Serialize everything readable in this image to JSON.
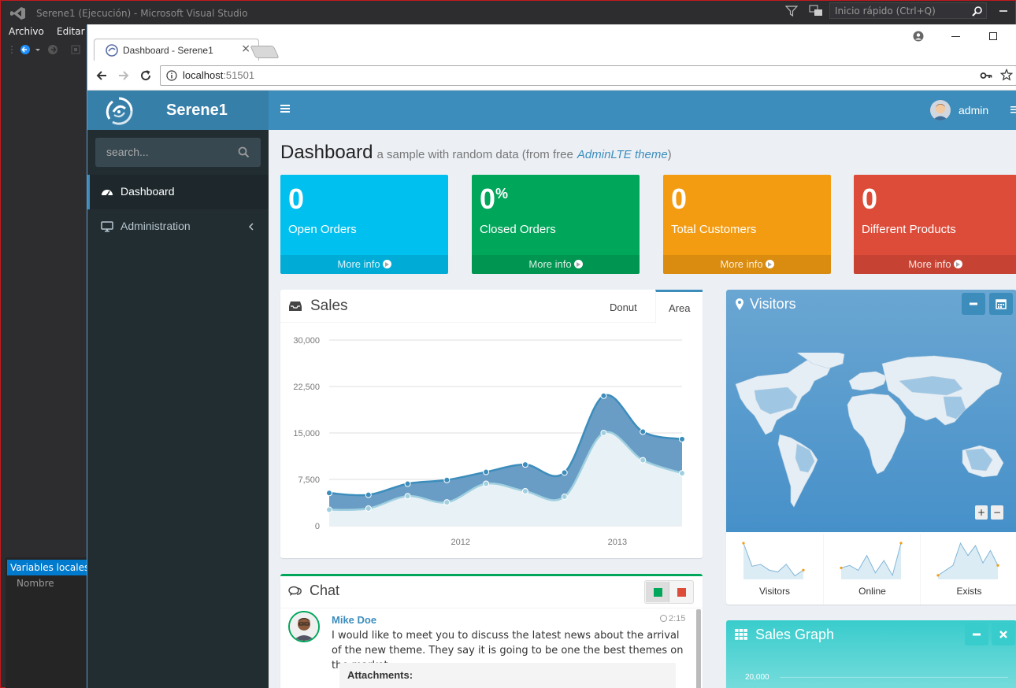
{
  "vs": {
    "title": "Serene1 (Ejecución) - Microsoft Visual Studio",
    "quick_launch": "Inicio rápido (Ctrl+Q)",
    "menu": [
      "Archivo",
      "Editar"
    ],
    "locals_tab": "Variables locales",
    "locals_column": "Nombre"
  },
  "browser": {
    "tab_title": "Dashboard - Serene1",
    "tab_close": "×",
    "url_host": "localhost",
    "url_port": ":51501"
  },
  "app": {
    "logo_text": "Serene1",
    "user": "admin",
    "search_placeholder": "search...",
    "nav": [
      {
        "label": "Dashboard",
        "active": true
      },
      {
        "label": "Administration",
        "active": false
      }
    ]
  },
  "header": {
    "title": "Dashboard",
    "subtitle": "a sample with random data (from free",
    "link": "AdminLTE theme",
    "close_paren": ")"
  },
  "stats": [
    {
      "value": "0",
      "suffix": "",
      "label": "Open Orders",
      "more": "More info",
      "color": "#00c0ef"
    },
    {
      "value": "0",
      "suffix": "%",
      "label": "Closed Orders",
      "more": "More info",
      "color": "#00a65a"
    },
    {
      "value": "0",
      "suffix": "",
      "label": "Total Customers",
      "more": "More info",
      "color": "#f39c12"
    },
    {
      "value": "0",
      "suffix": "",
      "label": "Different Products",
      "more": "More info",
      "color": "#dd4b39"
    }
  ],
  "sales": {
    "title": "Sales",
    "tabs": [
      "Donut",
      "Area"
    ]
  },
  "chart_data": {
    "type": "area",
    "title": "Sales",
    "xlabel": "",
    "ylabel": "",
    "ylim": [
      0,
      30000
    ],
    "yticks": [
      "0",
      "7,500",
      "15,000",
      "22,500",
      "30,000"
    ],
    "xticks": [
      {
        "label": "2012",
        "at": 3.35
      },
      {
        "label": "2013",
        "at": 7.35
      }
    ],
    "x": [
      0,
      1,
      2,
      3,
      4,
      5,
      6,
      7,
      8,
      9
    ],
    "series": [
      {
        "name": "",
        "color": "#3c8dbc",
        "values": [
          5300,
          5000,
          6800,
          7400,
          8700,
          9900,
          8600,
          21000,
          15200,
          14000
        ]
      },
      {
        "name": "",
        "color": "#a0d0e0",
        "values": [
          2600,
          2800,
          4800,
          3800,
          6800,
          5600,
          4700,
          15000,
          10600,
          8500
        ]
      }
    ],
    "grid": true
  },
  "visitors": {
    "title": "Visitors",
    "zoom_in": "+",
    "zoom_out": "−",
    "sparks": [
      {
        "label": "Visitors",
        "values": [
          90,
          30,
          35,
          20,
          15,
          35,
          5,
          20
        ]
      },
      {
        "label": "Online",
        "values": [
          20,
          25,
          15,
          45,
          10,
          35,
          5,
          70
        ]
      },
      {
        "label": "Exists",
        "values": [
          5,
          15,
          25,
          70,
          45,
          65,
          30,
          55,
          25
        ]
      }
    ]
  },
  "chat": {
    "title": "Chat",
    "name": "Mike Doe",
    "time": "2:15",
    "message": "I would like to meet you to discuss the latest news about the arrival of the new theme. They say it is going to be one the best themes on the market",
    "attachments": "Attachments:"
  },
  "sales_graph": {
    "title": "Sales Graph",
    "axis_label": "20,000"
  }
}
